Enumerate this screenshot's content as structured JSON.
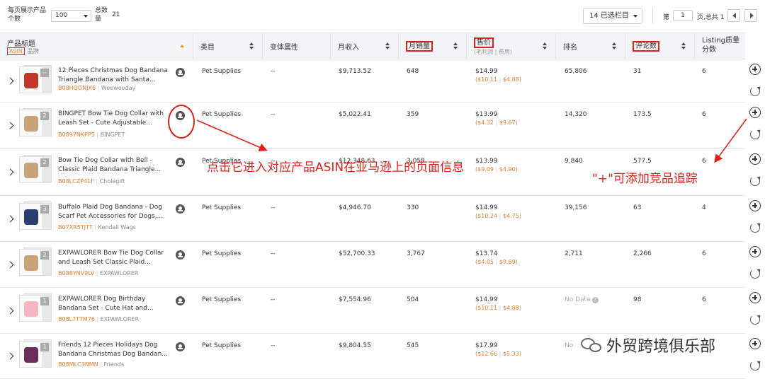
{
  "toolbar": {
    "per_page_label": "每页展示产品个数",
    "per_page_value": "100",
    "total_label": "总数量",
    "total_value": "21",
    "columns_button": "14 已选栏目",
    "page_prefix": "第",
    "page_value": "1",
    "page_suffix": "页,总共 1"
  },
  "header": {
    "title": "产品标题",
    "asin": "ASIN",
    "brand": "品牌",
    "category": "类目",
    "variant": "变体属性",
    "revenue": "月收入",
    "monthly_sales": "月销量",
    "price": "售价",
    "price_sub": "(毛利润 | 费用)",
    "rank": "排名",
    "reviews": "评论数",
    "listing_quality": "Listing质量分数"
  },
  "rows": [
    {
      "title": "12 Pieces Christmas Dog Bandana Triangle Bandana with Santa...",
      "asin": "B08HQGNJX6",
      "brand": "Weewooday",
      "thumb_count": "--",
      "category": "Pet Supplies",
      "variant": "--",
      "revenue": "$9,713.52",
      "sales": "648",
      "price": "$14.99",
      "profit": "($10.11",
      "fee": "$4.88)",
      "rank": "65,806",
      "reviews": "31",
      "quality": "6"
    },
    {
      "title": "BINGPET Bow Tie Dog Collar with Leash Set - Cute Adjustable...",
      "asin": "B0897NKPPS",
      "brand": "BINGPET",
      "thumb_count": "2",
      "category": "Pet Supplies",
      "variant": "--",
      "revenue": "$5,022.41",
      "sales": "359",
      "price": "$13.99",
      "profit": "($4.32",
      "fee": "$9.67)",
      "rank": "14,320",
      "reviews": "173.5",
      "quality": "6"
    },
    {
      "title": "Bow Tie Dog Collar with Bell - Classic Plaid Bandana Triangle...",
      "asin": "B08LCZP41F",
      "brand": "Cholegift",
      "thumb_count": "2",
      "category": "Pet Supplies",
      "variant": "--",
      "revenue": "$12,348.63",
      "sales": "3,058",
      "price": "$13.99",
      "profit": "($9.09",
      "fee": "$4.90)",
      "rank": "9,840",
      "reviews": "577.5",
      "quality": "6"
    },
    {
      "title": "Buffalo Plaid Dog Bandana - Dog Scarf Pet Accessories for Dogs,...",
      "asin": "B07XR5TJTT",
      "brand": "Kendall Wags",
      "thumb_count": "3",
      "category": "Pet Supplies",
      "variant": "--",
      "revenue": "$4,946.70",
      "sales": "330",
      "price": "$14.99",
      "profit": "($10.24",
      "fee": "$4.75)",
      "rank": "39,156",
      "reviews": "63",
      "quality": "4"
    },
    {
      "title": "EXPAWLORER Bow Tie Dog Collar and Leash Set Classic Plaid...",
      "asin": "B088YNV9LV",
      "brand": "EXPAWLORER",
      "thumb_count": "2",
      "category": "Pet Supplies",
      "variant": "--",
      "revenue": "$52,700.33",
      "sales": "3,767",
      "price": "$13.74",
      "profit": "($4.05",
      "fee": "$9.69)",
      "rank": "2,711",
      "reviews": "2,266",
      "quality": "6"
    },
    {
      "title": "EXPAWLORER Dog Birthday Bandana Set - Cute Hat and...",
      "asin": "B08L7TTM76",
      "brand": "EXPAWLORER",
      "thumb_count": "1",
      "category": "Pet Supplies",
      "variant": "--",
      "revenue": "$7,554.96",
      "sales": "504",
      "price": "$14.99",
      "profit": "($10.11",
      "fee": "$4.88)",
      "rank": "No Data",
      "reviews": "98",
      "quality": "6"
    },
    {
      "title": "Friends 12 Pieces Holidays Dog Bandana Christmas Dog Bandan...",
      "asin": "B08MLC3NMN",
      "brand": "Friends",
      "thumb_count": "1",
      "category": "Pet Supplies",
      "variant": "--",
      "revenue": "$9,804.55",
      "sales": "545",
      "price": "$17.99",
      "profit": "($12.66",
      "fee": "$5.33)",
      "rank": "No",
      "reviews": "",
      "quality": ""
    }
  ],
  "annotations": {
    "click_asin": "点击它进入对应产品ASIN在亚马逊上的页面信息",
    "add_tracking": "\"+\"可添加竞品追踪"
  },
  "watermark": "外贸跨境俱乐部",
  "colors": {
    "annotation_red": "#e0201a",
    "asin_orange": "#e87b2c",
    "header_bg": "#f3f4f7"
  }
}
